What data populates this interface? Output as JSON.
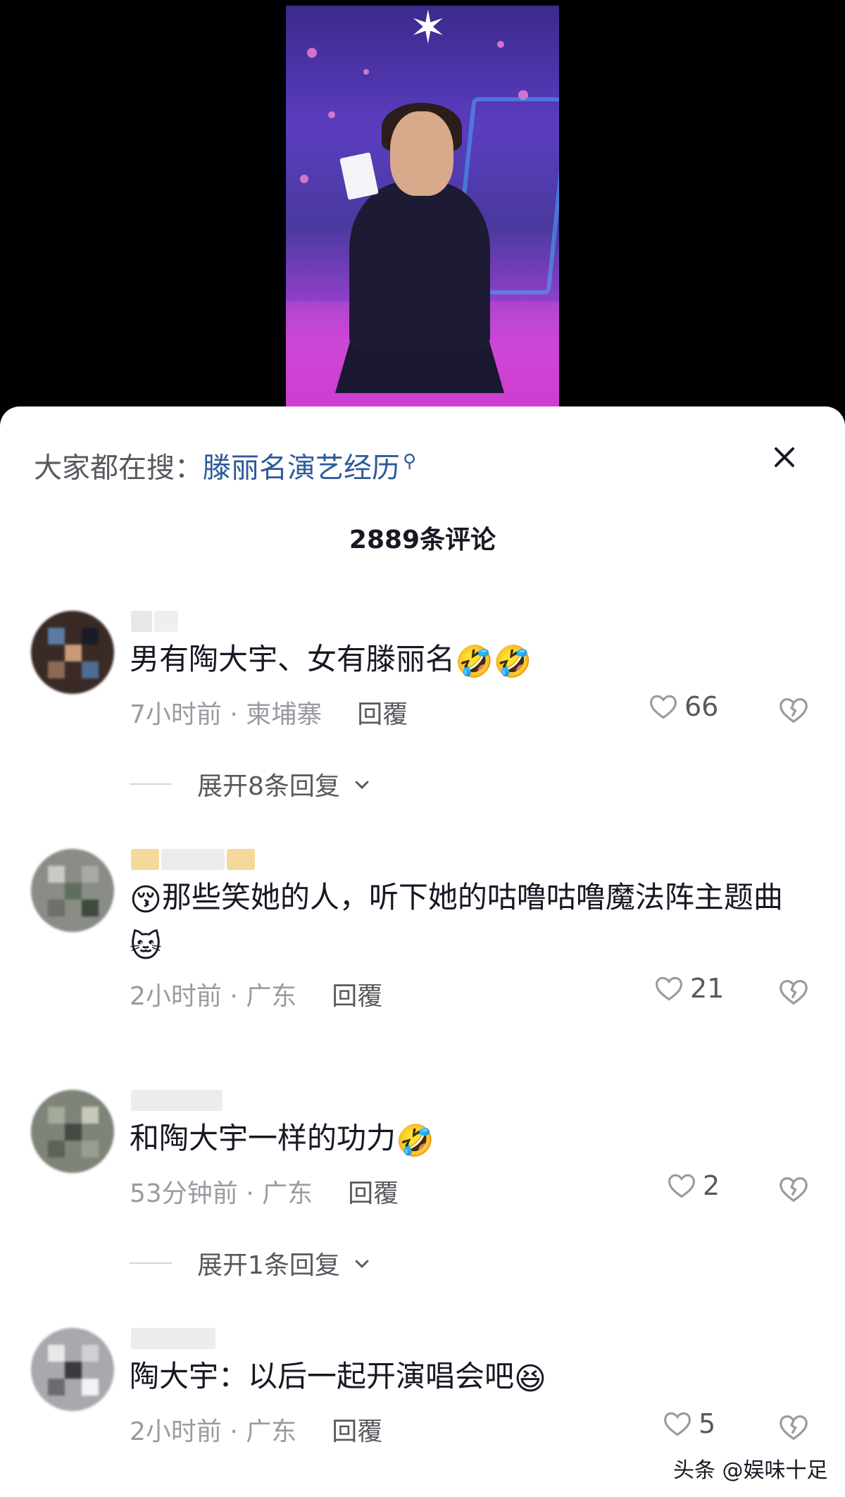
{
  "search_hint": {
    "prefix": "大家都在搜：",
    "term": "滕丽名演艺经历",
    "icon": "search-icon"
  },
  "comment_count_label": "2889条评论",
  "comments": [
    {
      "text": "男有陶大宇、女有滕丽名",
      "emoji_after": [
        "🤣",
        "🤣"
      ],
      "time_location": "7小时前 · 柬埔寨",
      "reply_label": "回覆",
      "likes": "66",
      "expand_label": "展开8条回复"
    },
    {
      "emoji_before": "😚",
      "text": "那些笑她的人，听下她的咕噜咕噜魔法阵主题曲",
      "emoji_after": [
        "🐱"
      ],
      "time_location": "2小时前 · 广东",
      "reply_label": "回覆",
      "likes": "21"
    },
    {
      "text": "和陶大宇一样的功力",
      "emoji_after": [
        "🤣"
      ],
      "time_location": "53分钟前 · 广东",
      "reply_label": "回覆",
      "likes": "2",
      "expand_label": "展开1条回复"
    },
    {
      "text": "陶大宇：以后一起开演唱会吧",
      "emoji_after": [
        "😆"
      ],
      "time_location": "2小时前 · 广东",
      "reply_label": "回覆",
      "likes": "5"
    }
  ],
  "watermark": "头条 @娱味十足",
  "colors": {
    "link_blue": "#2e5b9a",
    "meta_gray": "#9a9ba1",
    "text_dark": "#161823"
  }
}
